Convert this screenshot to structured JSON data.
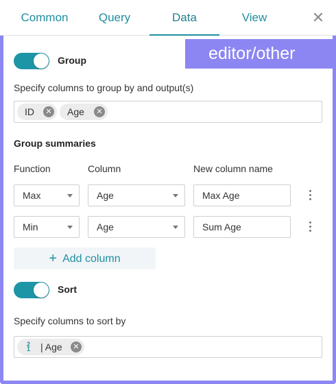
{
  "tabs": [
    {
      "label": "Common",
      "active": false
    },
    {
      "label": "Query",
      "active": false
    },
    {
      "label": "Data",
      "active": true
    },
    {
      "label": "View",
      "active": false
    }
  ],
  "close_icon": "close-icon",
  "watermark": "editor/other",
  "group": {
    "toggle_label": "Group",
    "toggle_on": true,
    "hint": "Specify columns to group by and output(s)",
    "chips": [
      "ID",
      "Age"
    ]
  },
  "summaries": {
    "title": "Group summaries",
    "headers": {
      "function": "Function",
      "column": "Column",
      "new_name": "New column name"
    },
    "rows": [
      {
        "function": "Max",
        "column": "Age",
        "new_name": "Max Age"
      },
      {
        "function": "Min",
        "column": "Age",
        "new_name": "Sum Age"
      }
    ],
    "add_label": "Add column"
  },
  "sort": {
    "toggle_label": "Sort",
    "toggle_on": true,
    "hint": "Specify columns to sort by",
    "chips": [
      "| Age"
    ],
    "sort_icon": "sort-ascending-icon"
  },
  "colors": {
    "accent": "#1d95a6",
    "frame": "#8c86f2"
  }
}
